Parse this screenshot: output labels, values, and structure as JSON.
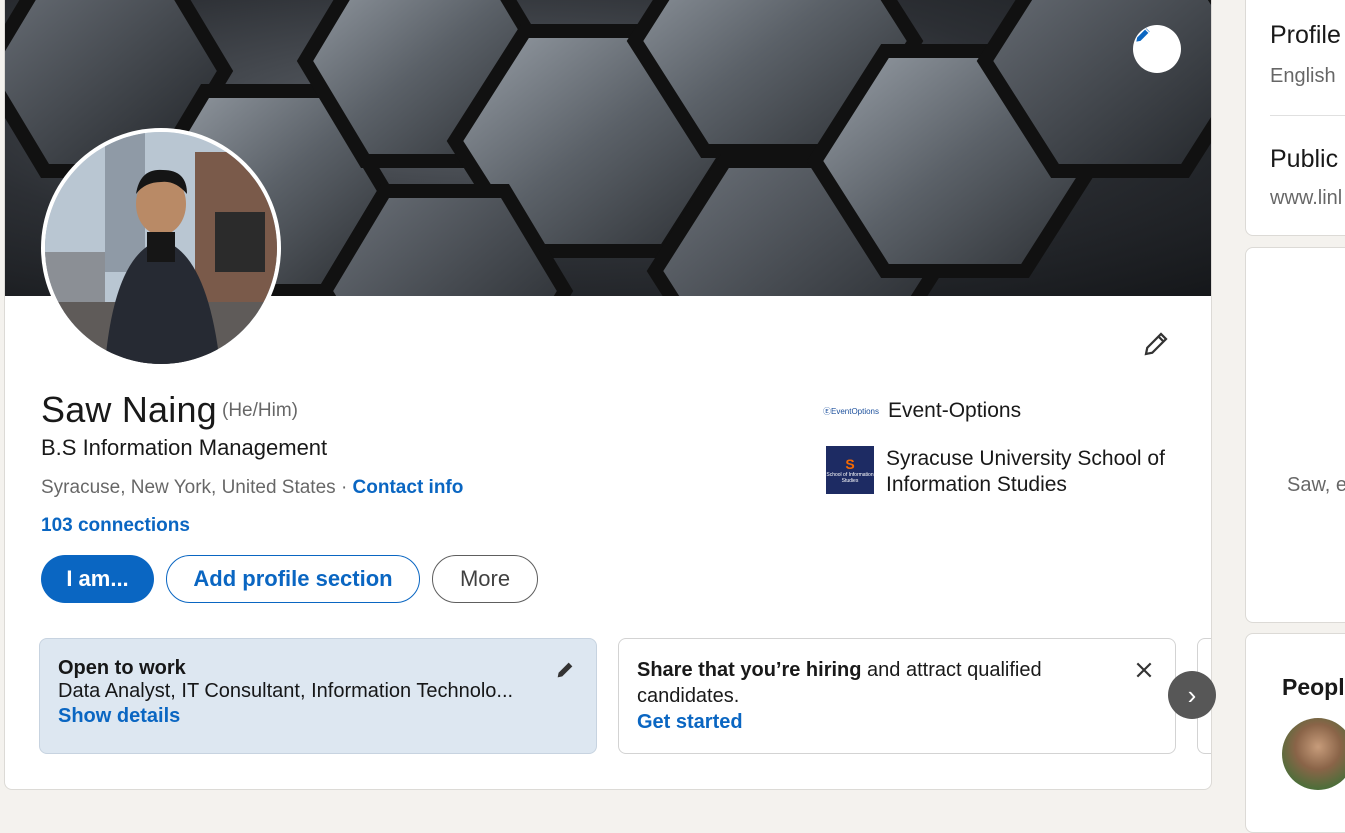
{
  "profile": {
    "name": "Saw Naing",
    "pronouns": "(He/Him)",
    "headline": "B.S Information Management",
    "location": "Syracuse, New York, United States",
    "separator": "·",
    "contact_info": "Contact info",
    "connections": "103 connections"
  },
  "actions": {
    "primary": "I am...",
    "add_section": "Add profile section",
    "more": "More"
  },
  "affiliations": [
    {
      "name": "Event-Options",
      "logo_text": "ⒺEventOptions"
    },
    {
      "name_line1": "Syracuse University School of",
      "name_line2": "Information Studies",
      "logo_letter": "S",
      "logo_caption": "School of Information Studies"
    }
  ],
  "open_to_work": {
    "title": "Open to work",
    "roles": "Data Analyst, IT Consultant, Information Technolo...",
    "link": "Show details"
  },
  "hiring": {
    "bold": "Share that you’re hiring",
    "rest": " and attract qualified",
    "line2": "candidates.",
    "link": "Get started"
  },
  "rail": {
    "profile_lang_title": "Profile",
    "profile_lang_value": "English",
    "public_title": "Public",
    "public_value": "www.linl",
    "ad_text": "Saw, e",
    "people_title": "People"
  },
  "colors": {
    "accent": "#0a66c2",
    "open_to_work_bg": "#dde7f1",
    "next_button": "#575757"
  }
}
